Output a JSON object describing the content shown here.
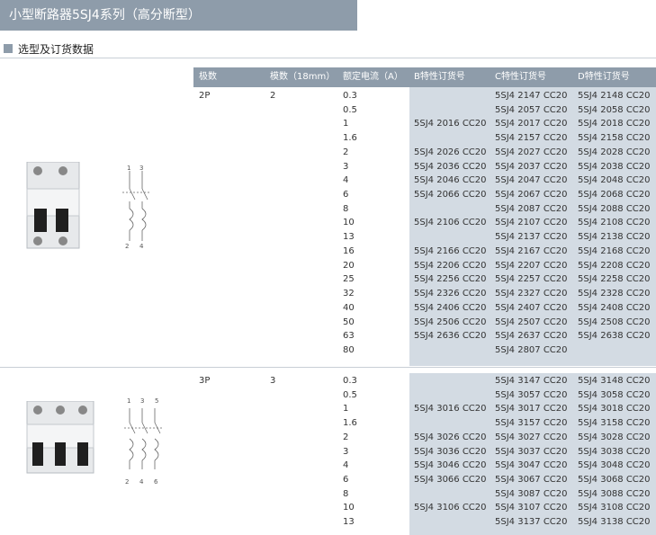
{
  "title": "小型断路器5SJ4系列（高分断型）",
  "section": "选型及订货数据",
  "headers": [
    "极数",
    "模数（18mm）",
    "额定电流（A）",
    "B特性订货号",
    "C特性订货号",
    "D特性订货号"
  ],
  "groups": [
    {
      "pole": "2P",
      "modules": "2",
      "terminals_top": [
        "1",
        "3"
      ],
      "terminals_bottom": [
        "2",
        "4"
      ],
      "rows": [
        {
          "current": "0.3",
          "b": "",
          "c": "5SJ4 2147 CC20",
          "d": "5SJ4 2148 CC20"
        },
        {
          "current": "0.5",
          "b": "",
          "c": "5SJ4 2057 CC20",
          "d": "5SJ4 2058 CC20"
        },
        {
          "current": "1",
          "b": "5SJ4 2016 CC20",
          "c": "5SJ4 2017 CC20",
          "d": "5SJ4 2018 CC20"
        },
        {
          "current": "1.6",
          "b": "",
          "c": "5SJ4 2157 CC20",
          "d": "5SJ4 2158 CC20"
        },
        {
          "current": "2",
          "b": "5SJ4 2026 CC20",
          "c": "5SJ4 2027 CC20",
          "d": "5SJ4 2028 CC20"
        },
        {
          "current": "3",
          "b": "5SJ4 2036 CC20",
          "c": "5SJ4 2037 CC20",
          "d": "5SJ4 2038 CC20"
        },
        {
          "current": "4",
          "b": "5SJ4 2046 CC20",
          "c": "5SJ4 2047 CC20",
          "d": "5SJ4 2048 CC20"
        },
        {
          "current": "6",
          "b": "5SJ4 2066 CC20",
          "c": "5SJ4 2067 CC20",
          "d": "5SJ4 2068 CC20"
        },
        {
          "current": "8",
          "b": "",
          "c": "5SJ4 2087 CC20",
          "d": "5SJ4 2088 CC20"
        },
        {
          "current": "10",
          "b": "5SJ4 2106 CC20",
          "c": "5SJ4 2107 CC20",
          "d": "5SJ4 2108 CC20"
        },
        {
          "current": "13",
          "b": "",
          "c": "5SJ4 2137 CC20",
          "d": "5SJ4 2138 CC20"
        },
        {
          "current": "16",
          "b": "5SJ4 2166 CC20",
          "c": "5SJ4 2167 CC20",
          "d": "5SJ4 2168 CC20"
        },
        {
          "current": "20",
          "b": "5SJ4 2206 CC20",
          "c": "5SJ4 2207 CC20",
          "d": "5SJ4 2208 CC20"
        },
        {
          "current": "25",
          "b": "5SJ4 2256 CC20",
          "c": "5SJ4 2257 CC20",
          "d": "5SJ4 2258 CC20"
        },
        {
          "current": "32",
          "b": "5SJ4 2326 CC20",
          "c": "5SJ4 2327 CC20",
          "d": "5SJ4 2328 CC20"
        },
        {
          "current": "40",
          "b": "5SJ4 2406 CC20",
          "c": "5SJ4 2407 CC20",
          "d": "5SJ4 2408 CC20"
        },
        {
          "current": "50",
          "b": "5SJ4 2506 CC20",
          "c": "5SJ4 2507 CC20",
          "d": "5SJ4 2508 CC20"
        },
        {
          "current": "63",
          "b": "5SJ4 2636 CC20",
          "c": "5SJ4 2637 CC20",
          "d": "5SJ4 2638 CC20"
        },
        {
          "current": "80",
          "b": "",
          "c": "5SJ4 2807 CC20",
          "d": ""
        }
      ]
    },
    {
      "pole": "3P",
      "modules": "3",
      "terminals_top": [
        "1",
        "3",
        "5"
      ],
      "terminals_bottom": [
        "2",
        "4",
        "6"
      ],
      "rows": [
        {
          "current": "0.3",
          "b": "",
          "c": "5SJ4 3147 CC20",
          "d": "5SJ4 3148 CC20"
        },
        {
          "current": "0.5",
          "b": "",
          "c": "5SJ4 3057 CC20",
          "d": "5SJ4 3058 CC20"
        },
        {
          "current": "1",
          "b": "5SJ4 3016 CC20",
          "c": "5SJ4 3017 CC20",
          "d": "5SJ4 3018 CC20"
        },
        {
          "current": "1.6",
          "b": "",
          "c": "5SJ4 3157 CC20",
          "d": "5SJ4 3158 CC20"
        },
        {
          "current": "2",
          "b": "5SJ4 3026 CC20",
          "c": "5SJ4 3027 CC20",
          "d": "5SJ4 3028 CC20"
        },
        {
          "current": "3",
          "b": "5SJ4 3036 CC20",
          "c": "5SJ4 3037 CC20",
          "d": "5SJ4 3038 CC20"
        },
        {
          "current": "4",
          "b": "5SJ4 3046 CC20",
          "c": "5SJ4 3047 CC20",
          "d": "5SJ4 3048 CC20"
        },
        {
          "current": "6",
          "b": "5SJ4 3066 CC20",
          "c": "5SJ4 3067 CC20",
          "d": "5SJ4 3068 CC20"
        },
        {
          "current": "8",
          "b": "",
          "c": "5SJ4 3087 CC20",
          "d": "5SJ4 3088 CC20"
        },
        {
          "current": "10",
          "b": "5SJ4 3106 CC20",
          "c": "5SJ4 3107 CC20",
          "d": "5SJ4 3108 CC20"
        },
        {
          "current": "13",
          "b": "",
          "c": "5SJ4 3137 CC20",
          "d": "5SJ4 3138 CC20"
        }
      ]
    }
  ]
}
